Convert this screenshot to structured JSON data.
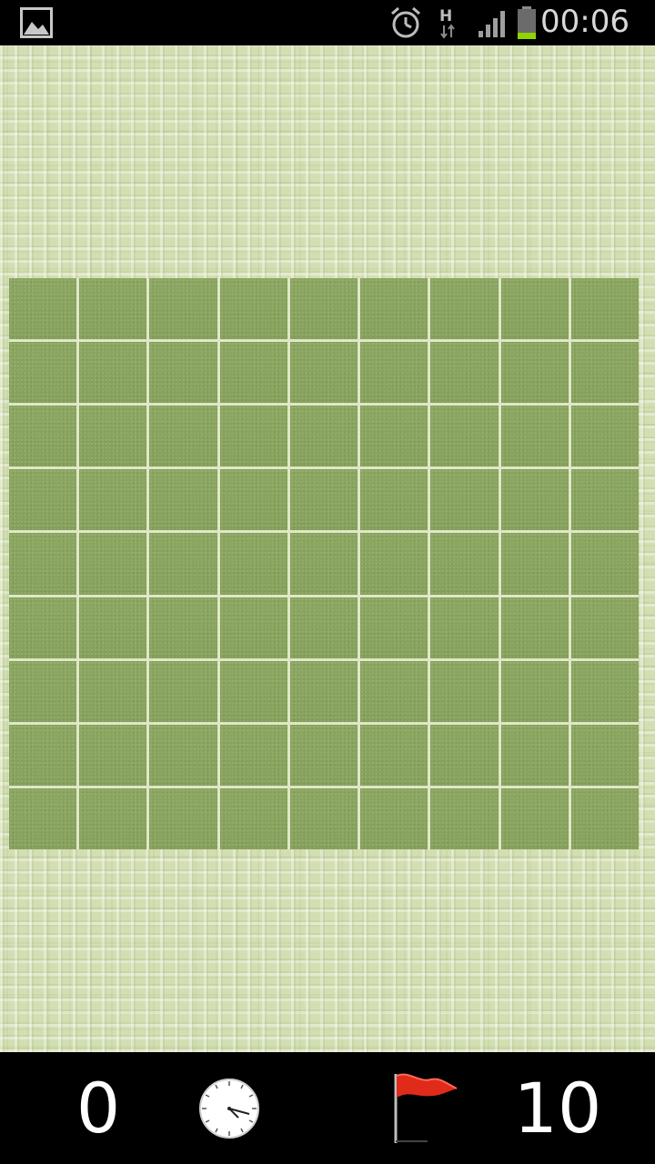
{
  "status_bar": {
    "time": "00:06",
    "icons": [
      "image-icon",
      "alarm-icon",
      "hspa-data-icon",
      "signal-icon",
      "battery-icon"
    ]
  },
  "board": {
    "rows": 9,
    "cols": 9,
    "cell_state": "covered"
  },
  "footer": {
    "timer_value": "0",
    "clock_icon": "clock-icon",
    "flag_icon": "flag-icon",
    "mines_remaining": "10"
  },
  "colors": {
    "cell": "#88a35d",
    "background": "#d3dfb3",
    "bar": "#000000",
    "flag": "#e02a1a"
  }
}
